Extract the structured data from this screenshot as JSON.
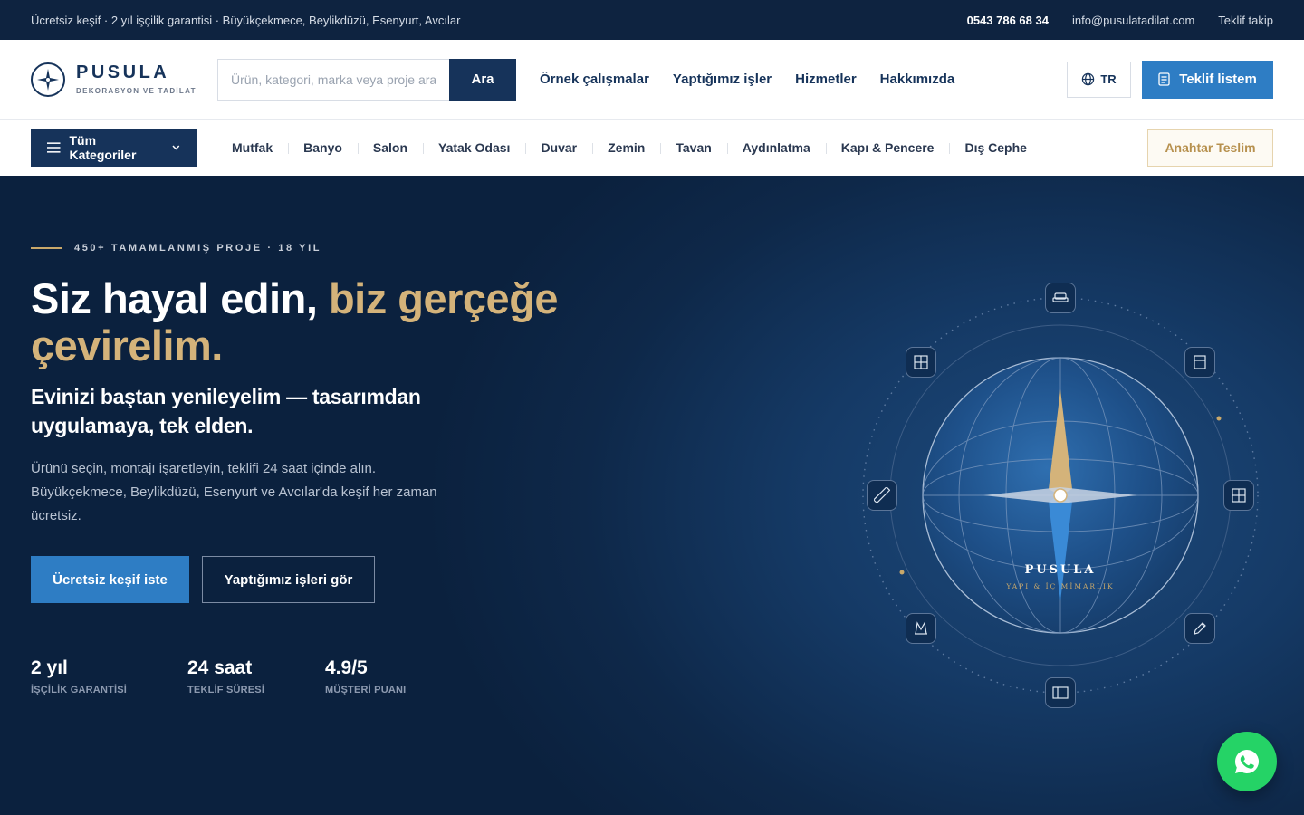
{
  "topbar": {
    "info": "Ücretsiz keşif · 2 yıl işçilik garantisi · Büyükçekmece, Beylikdüzü, Esenyurt, Avcılar",
    "phone": "0543 786 68 34",
    "email": "info@pusulatadilat.com",
    "track": "Teklif takip"
  },
  "header": {
    "logo_name": "PUSULA",
    "logo_sub": "DEKORASYON VE TADİLAT",
    "search_placeholder": "Ürün, kategori, marka veya proje ara...",
    "search_button": "Ara",
    "nav": [
      "Örnek çalışmalar",
      "Yaptığımız işler",
      "Hizmetler",
      "Hakkımızda"
    ],
    "lang": "TR",
    "quote_button": "Teklif listem"
  },
  "catbar": {
    "all_label": "Tüm Kategoriler",
    "categories": [
      "Mutfak",
      "Banyo",
      "Salon",
      "Yatak Odası",
      "Duvar",
      "Zemin",
      "Tavan",
      "Aydınlatma",
      "Kapı & Pencere",
      "Dış Cephe"
    ],
    "turnkey": "Anahtar Teslim"
  },
  "hero": {
    "eyebrow": "450+ TAMAMLANMIŞ PROJE · 18 YIL",
    "title_white": "Siz hayal edin,",
    "title_gold": "biz gerçeğe çevirelim.",
    "subtitle": "Evinizi baştan yenileyelim — tasarımdan uygulamaya, tek elden.",
    "desc": "Ürünü seçin, montajı işaretleyin, teklifi 24 saat içinde alın. Büyükçekmece, Beylikdüzü, Esenyurt ve Avcılar'da keşif her zaman ücretsiz.",
    "cta_primary": "Ücretsiz keşif iste",
    "cta_secondary": "Yaptığımız işleri gör",
    "stats": [
      {
        "value": "2 yıl",
        "label": "İŞÇİLİK GARANTİSİ"
      },
      {
        "value": "24 saat",
        "label": "TEKLİF SÜRESİ"
      },
      {
        "value": "4.9/5",
        "label": "MÜŞTERİ PUANI"
      }
    ],
    "globe_title": "PUSULA",
    "globe_sub": "YAPI & İÇ MİMARLIK"
  },
  "colors": {
    "navy": "#16335a",
    "accent_blue": "#2e7dc4",
    "gold": "#d4b37a",
    "whatsapp": "#25d366"
  }
}
